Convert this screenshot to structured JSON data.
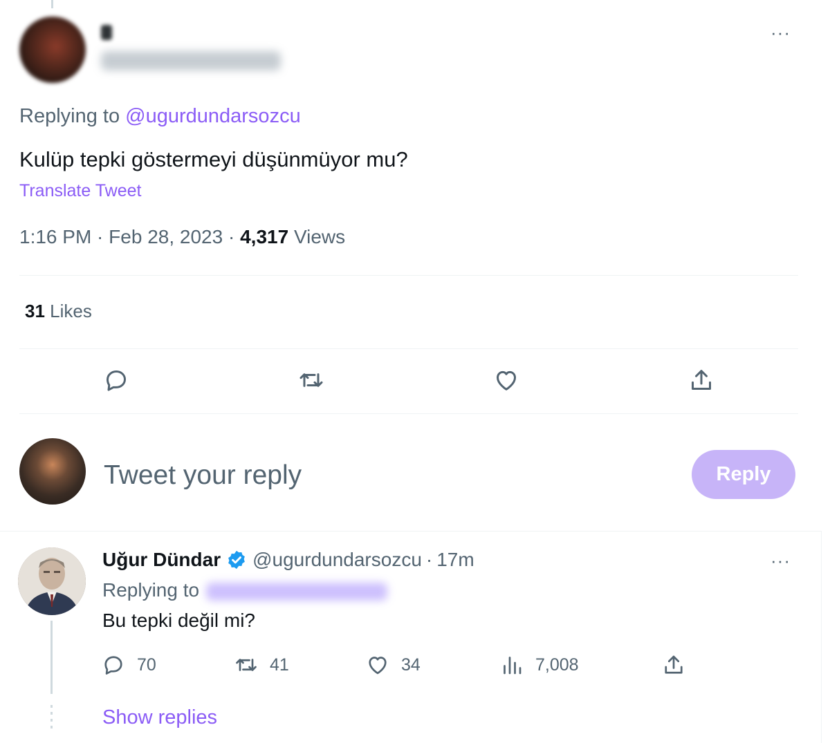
{
  "main_tweet": {
    "replying_prefix": "Replying to ",
    "replying_to": "@ugurdundarsozcu",
    "text": "Kulüp tepki göstermeyi düşünmüyor mu?",
    "translate_label": "Translate Tweet",
    "time": "1:16 PM",
    "date": "Feb 28, 2023",
    "views_count": "4,317",
    "views_label": "Views",
    "likes_count": "31",
    "likes_label": "Likes",
    "more_label": "···"
  },
  "actions": {
    "icons": [
      "reply-icon",
      "retweet-icon",
      "like-icon",
      "share-icon"
    ]
  },
  "composer": {
    "placeholder": "Tweet your reply",
    "reply_button": "Reply"
  },
  "reply_tweet": {
    "name": "Uğur Dündar",
    "handle": "@ugurdundarsozcu",
    "separator": "·",
    "time_ago": "17m",
    "replying_prefix": "Replying to",
    "text": "Bu tepki değil mi?",
    "replies": "70",
    "retweets": "41",
    "likes": "34",
    "views": "7,008",
    "more_label": "···",
    "show_replies": "Show replies"
  },
  "colors": {
    "accent": "#8b5cf6",
    "reply_button": "#c7b4f8",
    "muted": "#536471",
    "verified": "#1d9bf0"
  }
}
